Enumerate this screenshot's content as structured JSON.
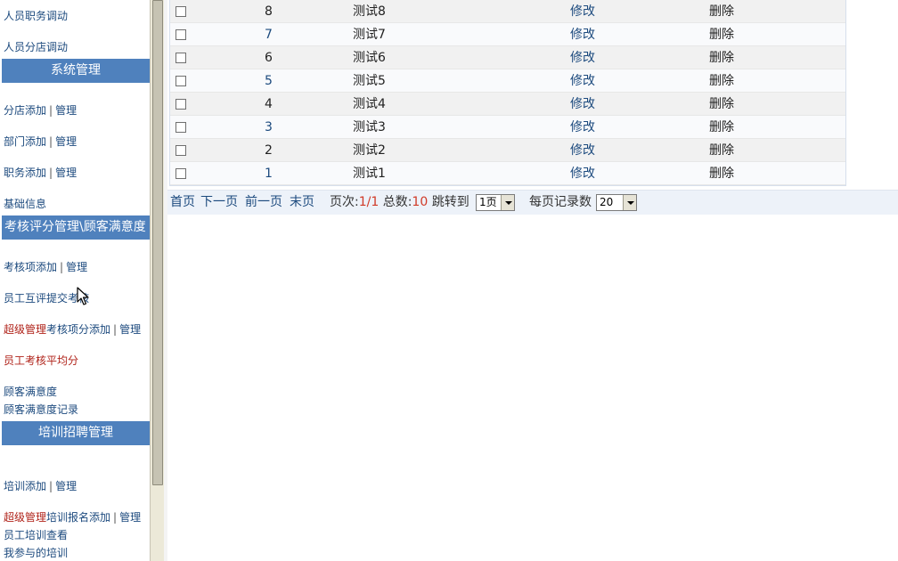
{
  "sidebar": {
    "items": [
      {
        "label": "人员职务调动"
      },
      {
        "label": "人员分店调动"
      }
    ],
    "sections": {
      "system": {
        "title": "系统管理",
        "items": [
          {
            "prefix": "分店",
            "add": "添加",
            "sep": "|",
            "manage": "管理"
          },
          {
            "prefix": "部门",
            "add": "添加",
            "sep": "|",
            "manage": "管理"
          },
          {
            "prefix": "职务",
            "add": "添加",
            "sep": "|",
            "manage": "管理"
          },
          {
            "label": "基础信息"
          }
        ]
      },
      "assessment": {
        "title": "考核评分管理\\顾客满意度",
        "items": [
          {
            "prefix": "考核项",
            "add": "添加",
            "sep": "|",
            "manage": "管理"
          },
          {
            "label": "员工互评提交考核"
          },
          {
            "super": "超级管理",
            "prefix": "考核项分",
            "add": "添加",
            "sep": "|",
            "manage": "管理"
          },
          {
            "label": "员工考核平均分"
          },
          {
            "label": "顾客满意度"
          },
          {
            "label": "顾客满意度记录"
          }
        ]
      },
      "training": {
        "title": "培训招聘管理",
        "items": [
          {
            "prefix": "培训",
            "add": "添加",
            "sep": "|",
            "manage": "管理"
          },
          {
            "super": "超级管理",
            "prefix": "培训报名",
            "add": "添加",
            "sep": "|",
            "manage": "管理"
          },
          {
            "label": "员工培训查看"
          },
          {
            "label": "我参与的培训"
          }
        ]
      }
    }
  },
  "table": {
    "edit_label": "修改",
    "delete_label": "删除",
    "rows": [
      {
        "id": "8",
        "name": "测试8"
      },
      {
        "id": "7",
        "name": "测试7"
      },
      {
        "id": "6",
        "name": "测试6"
      },
      {
        "id": "5",
        "name": "测试5"
      },
      {
        "id": "4",
        "name": "测试4"
      },
      {
        "id": "3",
        "name": "测试3"
      },
      {
        "id": "2",
        "name": "测试2"
      },
      {
        "id": "1",
        "name": "测试1"
      }
    ]
  },
  "pager": {
    "first": "首页",
    "next": "下一页",
    "prev": "前一页",
    "last": "末页",
    "page_label": "页次:",
    "page_value": "1/1",
    "total_label": "总数:",
    "total_value": "10",
    "jump_label": "跳转到",
    "jump_value": "1页",
    "per_page_label": "每页记录数",
    "per_page_value": "20"
  },
  "colors": {
    "sidebar_header": "#4f81bd",
    "link": "#1c4a7e",
    "highlight_red": "#b0231a",
    "pager_bg": "#edf2f9"
  }
}
